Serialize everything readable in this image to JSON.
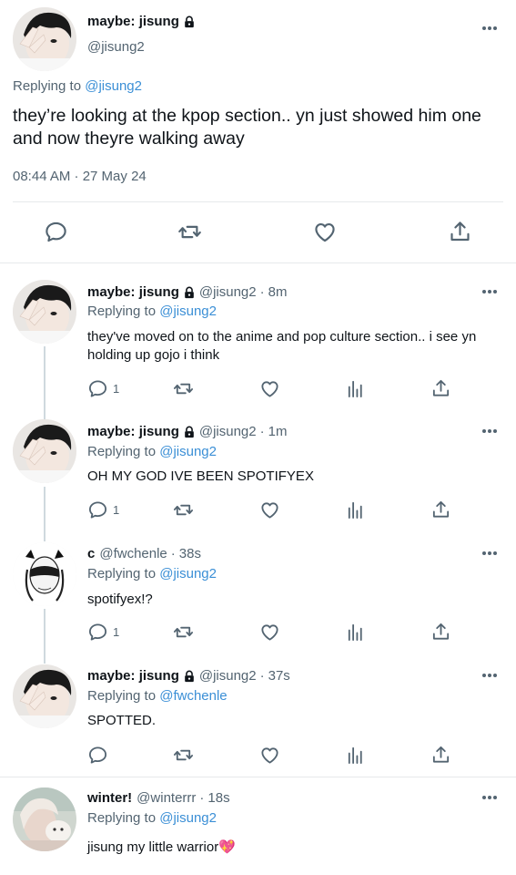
{
  "main": {
    "name": "maybe: jisung",
    "handle": "@jisung2",
    "replying_prefix": "Replying to",
    "replying_to": "@jisung2",
    "text": "they’re looking at the kpop section.. yn just showed him one and now theyre walking away",
    "timestamp": "08:44 AM · 27 May 24"
  },
  "replies": [
    {
      "name": "maybe: jisung",
      "handle": "@jisung2",
      "time": "8m",
      "replying_prefix": "Replying to",
      "replying_to": "@jisung2",
      "text": "they've moved on to the anime and pop culture section.. i see yn holding up gojo i think",
      "reply_count": "1",
      "locked": true
    },
    {
      "name": "maybe: jisung",
      "handle": "@jisung2",
      "time": "1m",
      "replying_prefix": "Replying to",
      "replying_to": "@jisung2",
      "text": "OH MY GOD IVE BEEN SPOTIFYEX",
      "reply_count": "1",
      "locked": true
    },
    {
      "name": "c",
      "handle": "@fwchenle",
      "time": "38s",
      "replying_prefix": "Replying to",
      "replying_to": "@jisung2",
      "text": "spotifyex!?",
      "reply_count": "1",
      "locked": false
    },
    {
      "name": "maybe: jisung",
      "handle": "@jisung2",
      "time": "37s",
      "replying_prefix": "Replying to",
      "replying_to": "@fwchenle",
      "text": "SPOTTED.",
      "reply_count": "",
      "locked": true
    },
    {
      "name": "winter!",
      "handle": "@winterrr",
      "time": "18s",
      "replying_prefix": "Replying to",
      "replying_to": "@jisung2",
      "text": "jisung my little warrior💖",
      "reply_count": "",
      "locked": false
    }
  ],
  "icons": {
    "reply": "reply-icon",
    "retweet": "retweet-icon",
    "like": "heart-icon",
    "share": "share-icon",
    "views": "views-icon",
    "more": "more-icon",
    "lock": "lock-icon"
  },
  "colors": {
    "mention": "#3b8fd6",
    "secondary": "#536471",
    "divider": "#e6e9eb"
  }
}
